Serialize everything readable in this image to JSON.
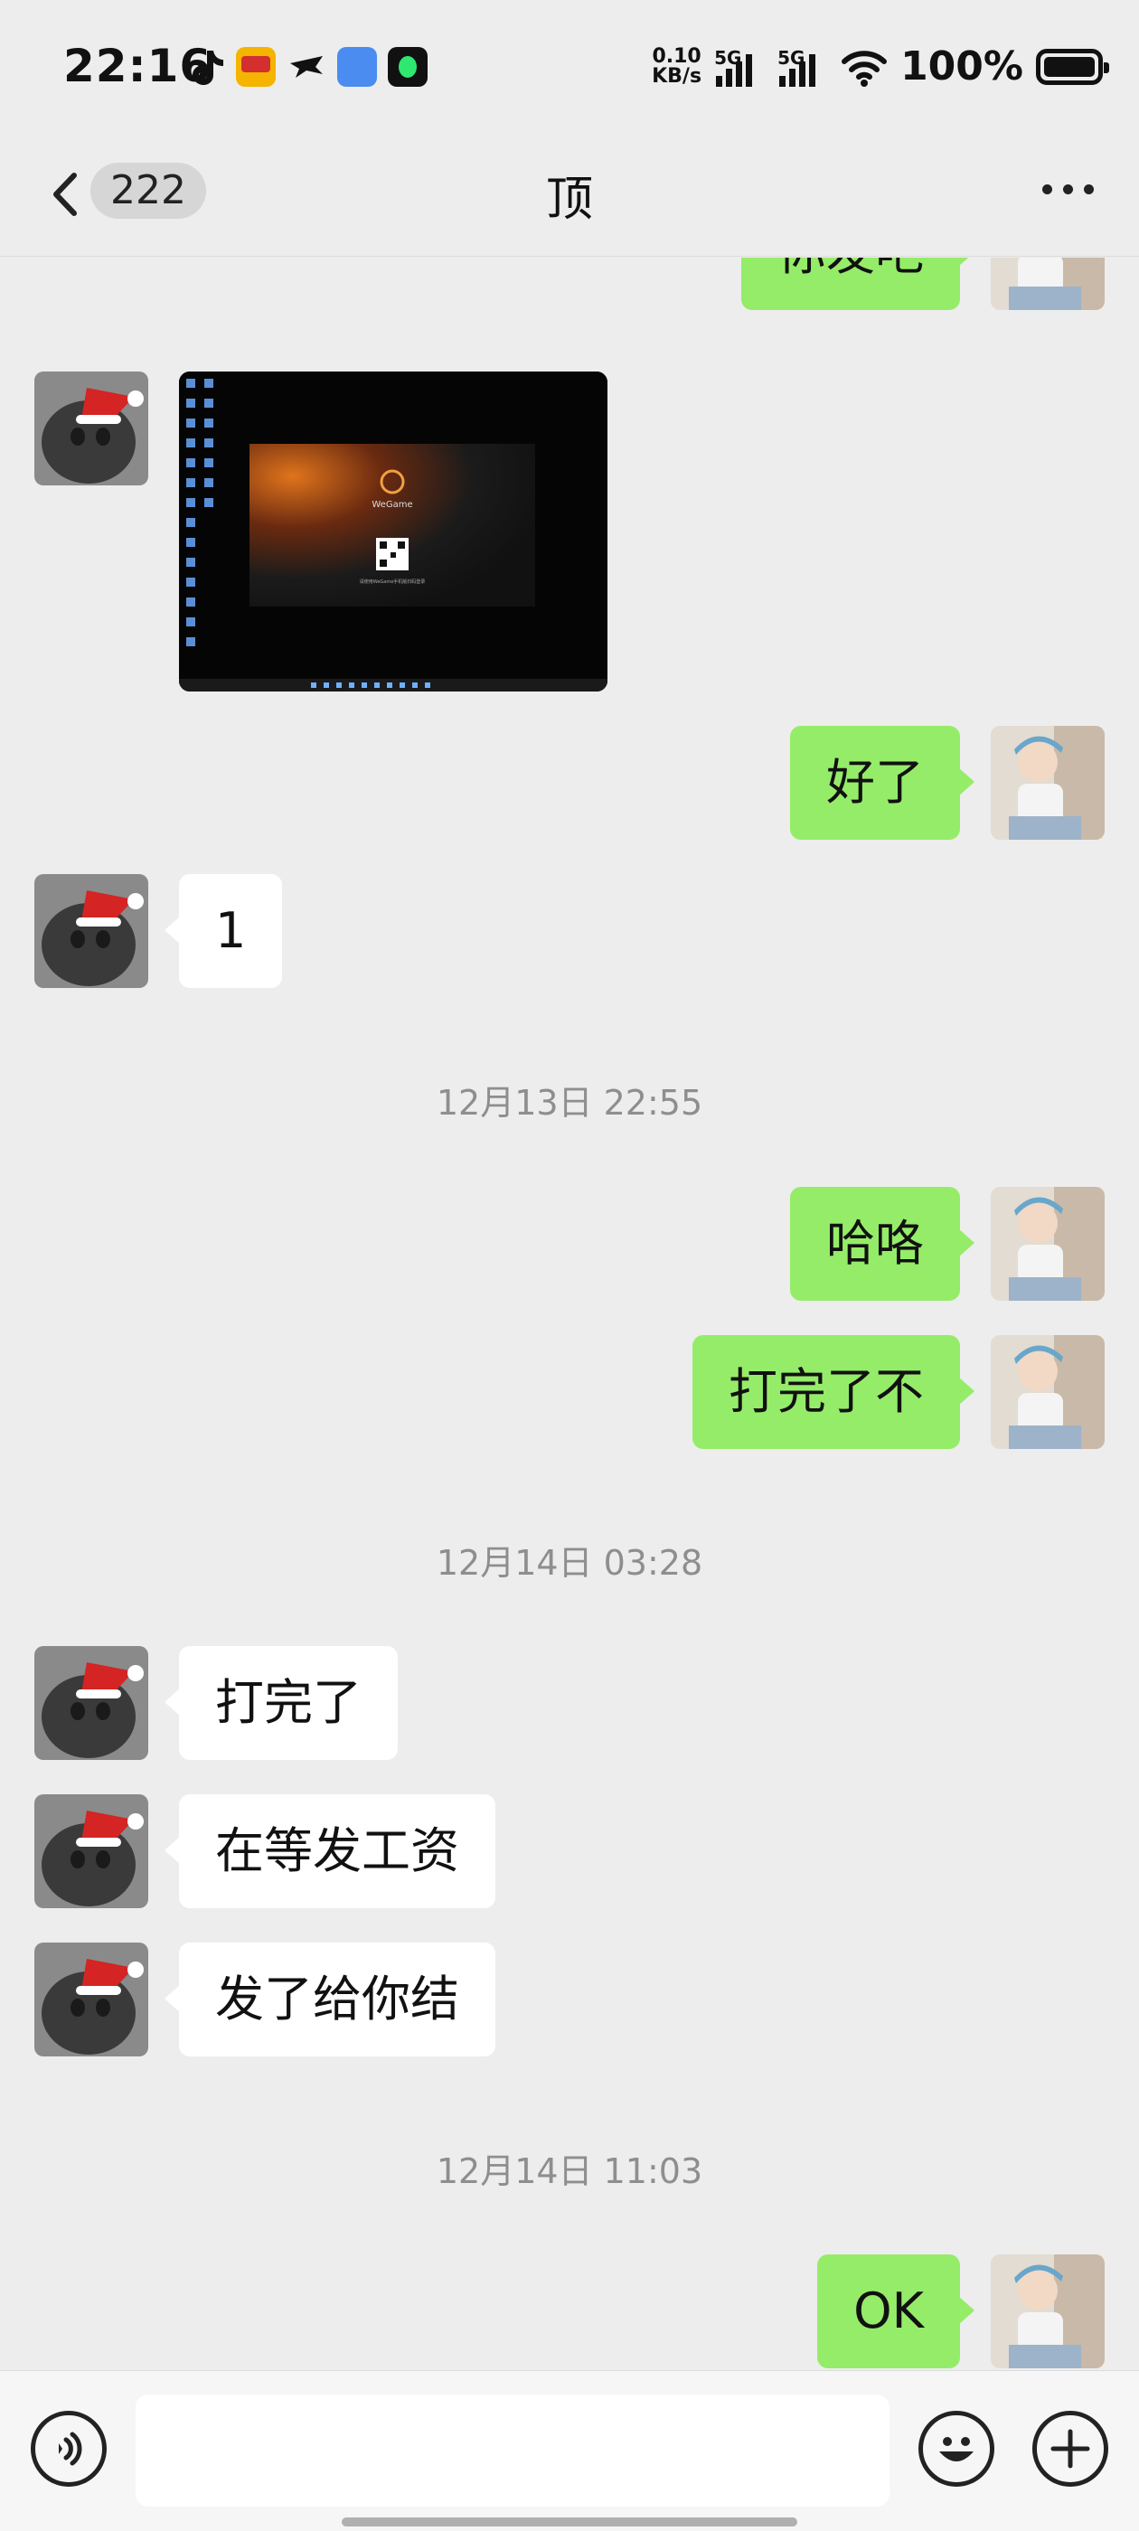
{
  "status_bar": {
    "time": "22:16",
    "net_speed_value": "0.10",
    "net_speed_unit": "KB/s",
    "sim1": "5G",
    "sim2": "5G",
    "battery": "100%",
    "app_icons": [
      "tiktok-icon",
      "game-app-icon",
      "bird-app-icon",
      "blue-app-icon",
      "music-app-icon"
    ]
  },
  "navbar": {
    "unread_count": "222",
    "title": "顶"
  },
  "messages": [
    {
      "side": "right",
      "text": "你发吧"
    },
    {
      "side": "left",
      "type": "image",
      "image_text": {
        "brand": "WeGame",
        "caption": "请使用WeGame手机版扫码登录"
      }
    },
    {
      "side": "right",
      "text": "好了"
    },
    {
      "side": "left",
      "text": "1"
    },
    {
      "type": "timestamp",
      "text": "12月13日 22:55"
    },
    {
      "side": "right",
      "text": "哈咯"
    },
    {
      "side": "right",
      "text": "打完了不"
    },
    {
      "type": "timestamp",
      "text": "12月14日 03:28"
    },
    {
      "side": "left",
      "text": "打完了"
    },
    {
      "side": "left",
      "text": "在等发工资"
    },
    {
      "side": "left",
      "text": "发了给你结"
    },
    {
      "type": "timestamp",
      "text": "12月14日 11:03"
    },
    {
      "side": "right",
      "text": "OK"
    }
  ],
  "colors": {
    "background": "#ededed",
    "sent_bubble": "#95ec69",
    "received_bubble": "#ffffff",
    "timestamp_text": "#8e8e8e"
  }
}
